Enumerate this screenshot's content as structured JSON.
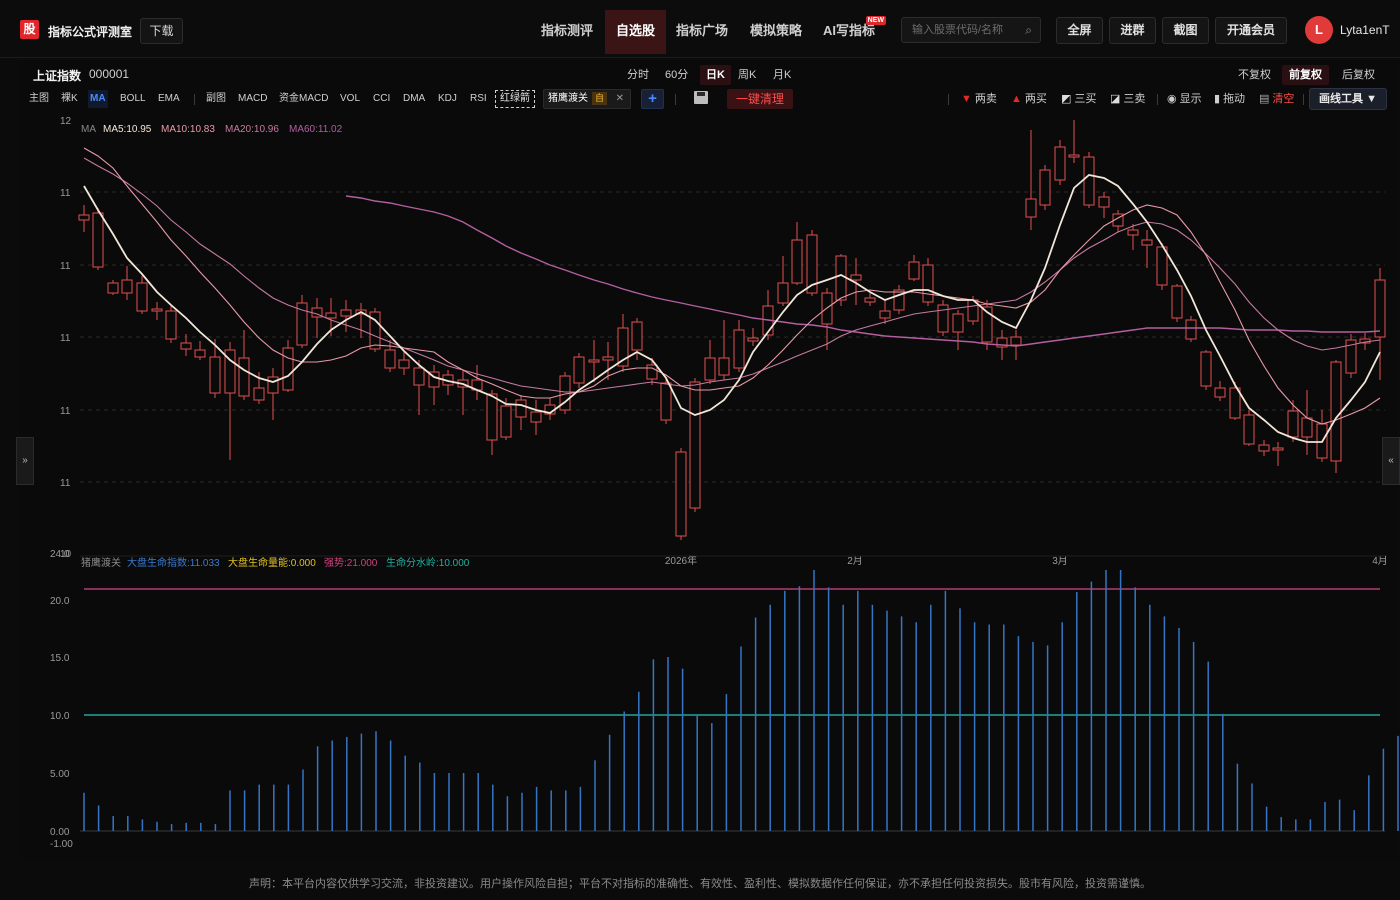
{
  "header": {
    "logo_char": "股",
    "brand": "指标公式评测室",
    "download": "下载",
    "nav": [
      {
        "label": "指标测评",
        "active": false
      },
      {
        "label": "自选股",
        "active": true
      },
      {
        "label": "指标广场",
        "active": false
      },
      {
        "label": "模拟策略",
        "active": false
      },
      {
        "label": "AI写指标",
        "active": false,
        "badge": "NEW"
      }
    ],
    "search_placeholder": "输入股票代码/名称",
    "fullscreen": "全屏",
    "join_group": "进群",
    "screenshot": "截图",
    "vip": "开通会员",
    "avatar_letter": "L",
    "username": "Lyta1enT"
  },
  "stock": {
    "name": "上证指数",
    "code": "000001"
  },
  "periods": [
    {
      "label": "分时",
      "active": false
    },
    {
      "label": "60分",
      "active": false
    },
    {
      "label": "日K",
      "active": true
    },
    {
      "label": "周K",
      "active": false
    },
    {
      "label": "月K",
      "active": false
    }
  ],
  "adjust": [
    {
      "label": "不复权",
      "active": false
    },
    {
      "label": "前复权",
      "active": true
    },
    {
      "label": "后复权",
      "active": false
    }
  ],
  "indicator_bar": {
    "items": [
      "主图",
      "裸K",
      "MA",
      "BOLL",
      "EMA"
    ],
    "sub_items": [
      "副图",
      "MACD",
      "资金MACD",
      "VOL",
      "CCI",
      "DMA",
      "KDJ",
      "RSI"
    ],
    "red_green": "红绿箭",
    "active_custom": "猪鹰渡关",
    "custom_tag": "自",
    "clear": "一键清理"
  },
  "tools": {
    "sell2": "两卖",
    "buy2": "两买",
    "buy3": "三买",
    "sell3": "三卖",
    "show": "显示",
    "drag": "拖动",
    "clear": "清空",
    "draw": "画线工具 ▼"
  },
  "colors": {
    "up": "#e05050",
    "down": "#13d13a",
    "ma5": "#f2e6d8",
    "ma10": "#e89aa8",
    "ma20": "#c57aa0",
    "ma60": "#b35fa0",
    "line20": "#b04070",
    "line10": "#22a49a",
    "bar": "#3575c4"
  },
  "main_chart": {
    "ma_legend": [
      {
        "label": "MA",
        "color": "#8a8a8a"
      },
      {
        "label": "MA5:10.95",
        "color": "#f2e6d8"
      },
      {
        "label": "MA10:10.83",
        "color": "#e89aa8"
      },
      {
        "label": "MA20:10.96",
        "color": "#c57aa0"
      },
      {
        "label": "MA60:11.02",
        "color": "#b35fa0"
      }
    ],
    "y_ticks": [
      "12",
      "11",
      "11",
      "11",
      "11",
      "11",
      "10"
    ],
    "x_ticks": [
      "2026年",
      "2月",
      "3月",
      "4月"
    ]
  },
  "sub_chart": {
    "legend": [
      {
        "label": "猪鹰渡关",
        "color": "#8a8a8a"
      },
      {
        "label": "大盘生命指数:11.033",
        "color": "#3a7ad0"
      },
      {
        "label": "大盘生命量能:0.000",
        "color": "#e0c020"
      },
      {
        "label": "强势:21.000",
        "color": "#d04080"
      },
      {
        "label": "生命分水岭:10.000",
        "color": "#20b0a0"
      }
    ],
    "y_ticks": [
      "24.0",
      "20.0",
      "15.0",
      "10.0",
      "5.00",
      "0.00",
      "-1.00"
    ]
  },
  "disclaimer": "声明：本平台内容仅供学习交流，非投资建议。用户操作风险自担；平台不对指标的准确性、有效性、盈利性、模拟数据作任何保证，亦不承担任何投资损失。股市有风险，投资需谨慎。"
}
